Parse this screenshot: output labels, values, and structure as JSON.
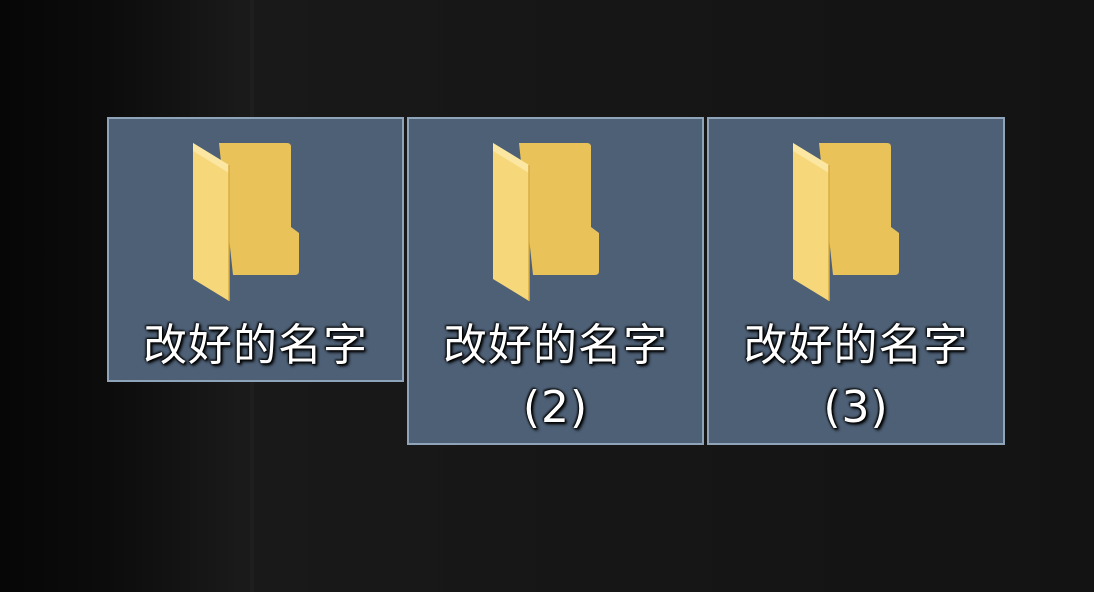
{
  "desktop": {
    "icons": [
      {
        "label": "改好的名字",
        "icon": "folder-icon",
        "selected": true
      },
      {
        "label": "改好的名字\n(2)",
        "icon": "folder-icon",
        "selected": true
      },
      {
        "label": "改好的名字\n(3)",
        "icon": "folder-icon",
        "selected": true
      }
    ]
  },
  "colors": {
    "selection_fill": "#4e6076",
    "selection_border": "#8fa4b8",
    "folder_front": "#f6d87a",
    "folder_back": "#e9c25a",
    "background": "#141414"
  }
}
